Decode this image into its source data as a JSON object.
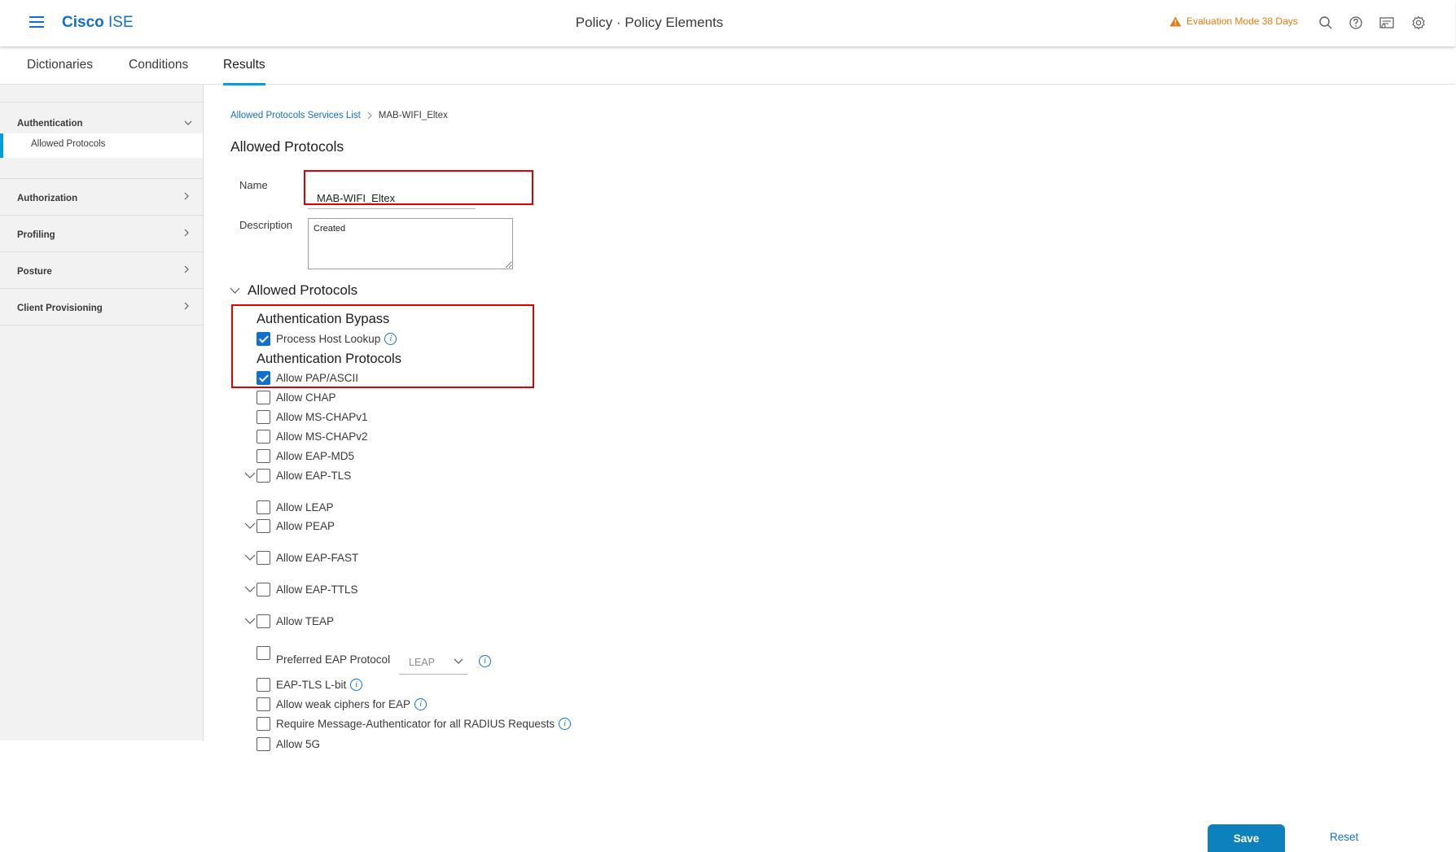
{
  "header": {
    "brand_bold": "Cisco",
    "brand_light": " ISE",
    "title": "Policy · Policy Elements",
    "evaluation": "Evaluation Mode 38 Days",
    "icons": [
      "warning-icon",
      "search-icon",
      "help-icon",
      "notifications-icon",
      "gear-icon"
    ]
  },
  "tabs": [
    {
      "label": "Dictionaries",
      "active": false
    },
    {
      "label": "Conditions",
      "active": false
    },
    {
      "label": "Results",
      "active": true
    }
  ],
  "sidebar": {
    "authentication": {
      "label": "Authentication",
      "expanded": true,
      "sub": "Allowed Protocols"
    },
    "sections": [
      {
        "label": "Authorization"
      },
      {
        "label": "Profiling"
      },
      {
        "label": "Posture"
      },
      {
        "label": "Client Provisioning"
      }
    ]
  },
  "breadcrumb": {
    "parent": "Allowed Protocols Services List",
    "current": "MAB-WIFI_Eltex"
  },
  "page_title": "Allowed Protocols",
  "form": {
    "name_label": "Name",
    "name_value": "MAB-WIFI_Eltex",
    "description_label": "Description",
    "description_value": "Created"
  },
  "protocols": {
    "section_title": "Allowed Protocols",
    "bypass_title": "Authentication Bypass",
    "protocols_title": "Authentication Protocols",
    "items": [
      {
        "label": "Process Host Lookup",
        "checked": true
      },
      {
        "label": "Allow PAP/ASCII",
        "checked": true
      },
      {
        "label": "Allow CHAP",
        "checked": false
      },
      {
        "label": "Allow MS-CHAPv1",
        "checked": false
      },
      {
        "label": "Allow MS-CHAPv2",
        "checked": false
      },
      {
        "label": "Allow EAP-MD5",
        "checked": false
      },
      {
        "label": "Allow EAP-TLS",
        "checked": false
      },
      {
        "label": "Allow LEAP",
        "checked": false
      },
      {
        "label": "Allow PEAP",
        "checked": false
      },
      {
        "label": "Allow EAP-FAST",
        "checked": false
      },
      {
        "label": "Allow EAP-TTLS",
        "checked": false
      },
      {
        "label": "Allow TEAP",
        "checked": false
      },
      {
        "label": "Preferred EAP Protocol",
        "checked": false
      },
      {
        "label": "EAP-TLS L-bit",
        "checked": false
      },
      {
        "label": "Allow weak ciphers for EAP",
        "checked": false
      },
      {
        "label": "Require Message-Authenticator for all RADIUS Requests",
        "checked": false
      },
      {
        "label": "Allow 5G",
        "checked": false
      }
    ],
    "preferred_eap_value": "LEAP"
  },
  "buttons": {
    "save": "Save",
    "reset": "Reset"
  },
  "colors": {
    "accent": "#1170cf",
    "tab_underline": "#049fd9",
    "warning": "#e07d10",
    "highlight_box": "#e10000",
    "save_button": "#0d81be"
  }
}
